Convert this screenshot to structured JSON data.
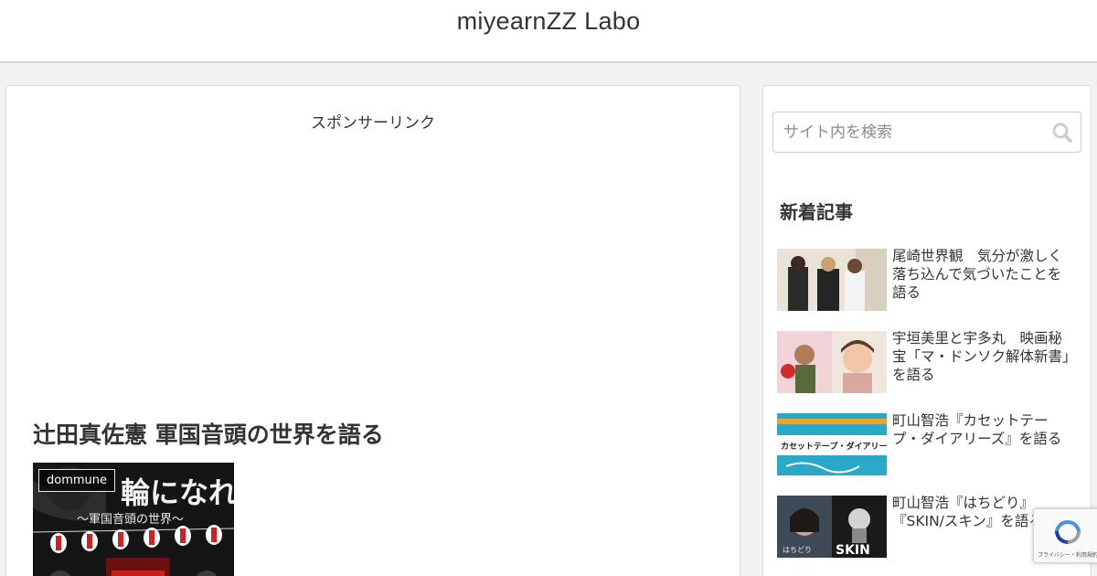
{
  "header": {
    "site_title": "miyearnZZ Labo"
  },
  "main": {
    "sponsor_label": "スポンサーリンク",
    "entry_title": "辻田真佐憲 軍国音頭の世界を語る",
    "eyecatch": {
      "category": "dommune",
      "image_title": "輪になれ",
      "image_subtitle": "〜軍国音頭の世界〜"
    }
  },
  "sidebar": {
    "search": {
      "placeholder": "サイト内を検索",
      "value": ""
    },
    "new_posts_title": "新着記事",
    "posts": [
      {
        "title": "尾崎世界観　気分が激しく落ち込んで気づいたことを語る"
      },
      {
        "title": "宇垣美里と宇多丸　映画秘宝「マ・ドンソク解体新書」を語る"
      },
      {
        "title": "町山智浩『カセットテープ・ダイアリーズ』を語る",
        "thumb_text": "カセットテープ・ダイアリーズ"
      },
      {
        "title": "町山智浩『はちどり』『SKIN/スキン』を語る",
        "thumb_text_left": "はちどり",
        "thumb_text_right": "SKIN"
      }
    ]
  },
  "recaptcha": {
    "footer_text": "プライバシー・利用規約"
  },
  "colors": {
    "background": "#f2f2f2",
    "card": "#ffffff",
    "text": "#333333",
    "border": "#dcdcdc"
  }
}
